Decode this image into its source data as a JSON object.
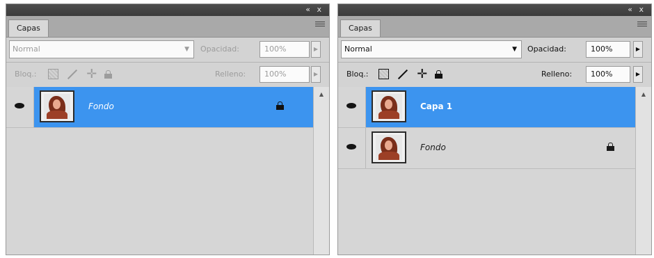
{
  "panels": [
    {
      "tab": "Capas",
      "blend_mode": "Normal",
      "opacity_label": "Opacidad:",
      "opacity_value": "100%",
      "lock_label": "Bloq.:",
      "fill_label": "Relleno:",
      "fill_value": "100%",
      "layers": [
        {
          "name": "Fondo"
        }
      ]
    },
    {
      "tab": "Capas",
      "blend_mode": "Normal",
      "opacity_label": "Opacidad:",
      "opacity_value": "100%",
      "lock_label": "Bloq.:",
      "fill_label": "Relleno:",
      "fill_value": "100%",
      "layers": [
        {
          "name": "Capa 1"
        },
        {
          "name": "Fondo"
        }
      ]
    }
  ],
  "titlebar_buttons": "«  x",
  "colors": {
    "selection": "#3c94ef",
    "titlebar": "#3b3b3b",
    "panel_bg": "#d6d6d6"
  },
  "icons": [
    "eye-icon",
    "lock-icon",
    "lock-transparent-icon",
    "lock-brush-icon",
    "lock-move-icon",
    "panel-menu-icon"
  ]
}
